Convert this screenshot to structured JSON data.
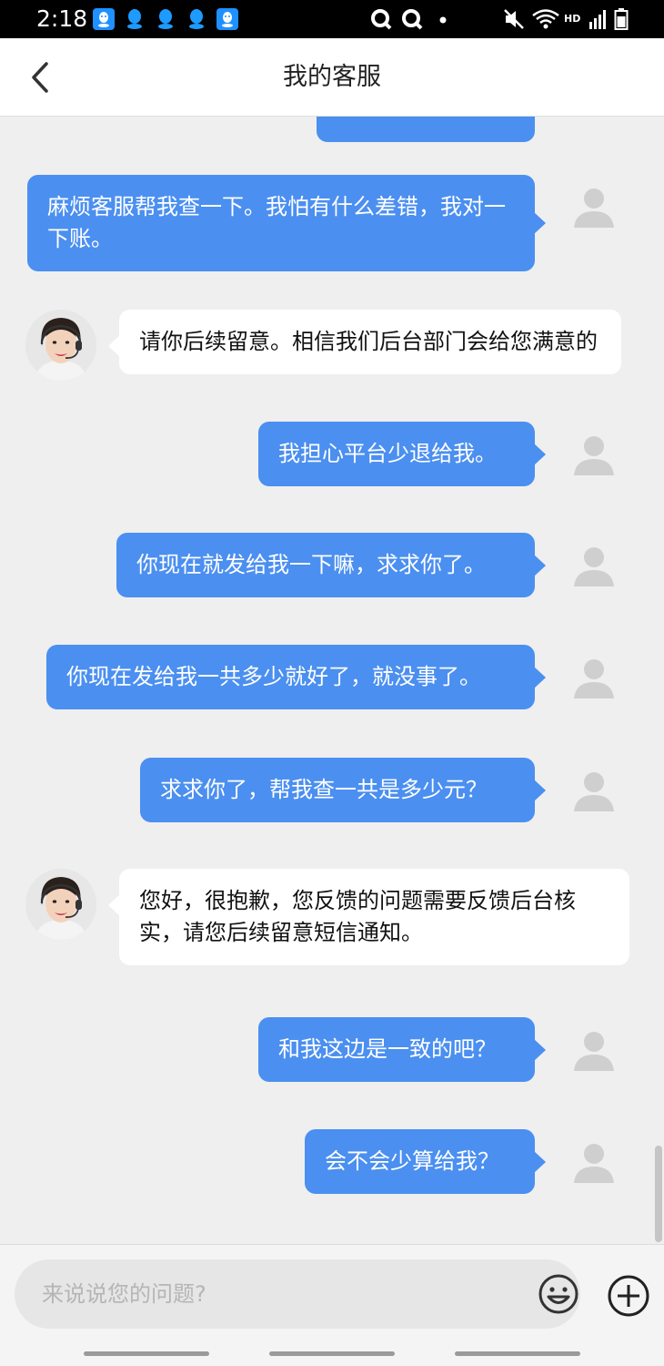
{
  "status_bar": {
    "time": "2:18",
    "hd_label": "HD",
    "app_icons": [
      "qq-icon",
      "qq-icon",
      "qq-icon",
      "qq-icon",
      "qq-icon"
    ],
    "right_icons": [
      "q-circle-icon",
      "q-circle-icon",
      "dot-icon",
      "mute-icon",
      "wifi-icon",
      "signal-icon",
      "battery-icon"
    ]
  },
  "nav": {
    "title": "我的客服",
    "back_icon": "chevron-left-icon"
  },
  "messages": [
    {
      "sender": "user",
      "text": ""
    },
    {
      "sender": "user",
      "text": "麻烦客服帮我查一下。我怕有什么差错，我对一下账。"
    },
    {
      "sender": "agent",
      "text": "请你后续留意。相信我们后台部门会给您满意的"
    },
    {
      "sender": "user",
      "text": "我担心平台少退给我。"
    },
    {
      "sender": "user",
      "text": "你现在就发给我一下嘛，求求你了。"
    },
    {
      "sender": "user",
      "text": "你现在发给我一共多少就好了，就没事了。"
    },
    {
      "sender": "user",
      "text": "求求你了，帮我查一共是多少元？"
    },
    {
      "sender": "agent",
      "text": "您好，很抱歉，您反馈的问题需要反馈后台核实，请您后续留意短信通知。"
    },
    {
      "sender": "user",
      "text": "和我这边是一致的吧？"
    },
    {
      "sender": "user",
      "text": "会不会少算给我？"
    }
  ],
  "input": {
    "placeholder": "来说说您的问题?",
    "emoji_icon": "smiley-icon",
    "plus_icon": "plus-circle-icon"
  },
  "colors": {
    "user_bubble": "#4b8ff0",
    "agent_bubble": "#ffffff",
    "chat_background": "#efefef"
  }
}
